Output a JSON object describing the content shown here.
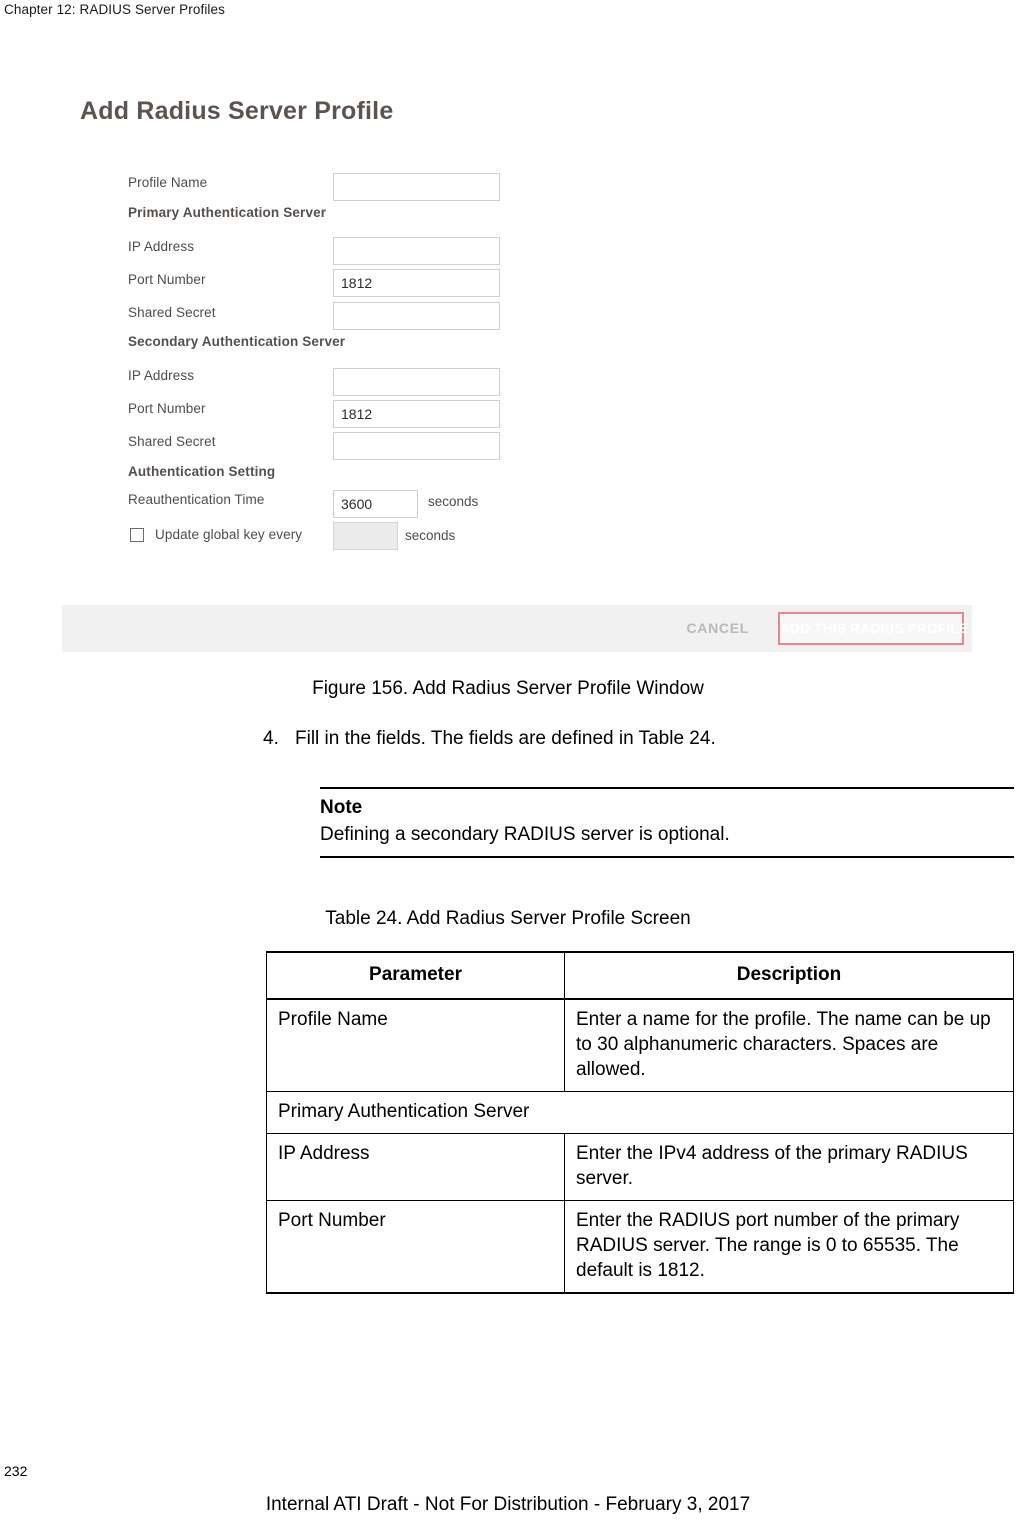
{
  "page": {
    "running_header": "Chapter 12: RADIUS Server Profiles",
    "page_number": "232",
    "footer_note": "Internal ATI Draft - Not For Distribution - February 3, 2017"
  },
  "figure": {
    "caption": "Figure 156. Add Radius Server Profile Window",
    "screenshot": {
      "title": "Add Radius Server Profile",
      "fields": {
        "profile_name_label": "Profile Name",
        "profile_name_value": "",
        "primary_section_label": "Primary Authentication Server",
        "primary_ip_label": "IP Address",
        "primary_ip_value": "",
        "primary_port_label": "Port Number",
        "primary_port_value": "1812",
        "primary_secret_label": "Shared Secret",
        "primary_secret_value": "",
        "secondary_section_label": "Secondary Authentication Server",
        "secondary_ip_label": "IP Address",
        "secondary_ip_value": "",
        "secondary_port_label": "Port Number",
        "secondary_port_value": "1812",
        "secondary_secret_label": "Shared Secret",
        "secondary_secret_value": "",
        "auth_section_label": "Authentication Setting",
        "reauth_label": "Reauthentication Time",
        "reauth_value": "3600",
        "reauth_unit": "seconds",
        "update_key_label": "Update global key every",
        "update_key_value": "",
        "update_key_unit": "seconds",
        "update_key_checked": false
      },
      "actions": {
        "cancel_label": "CANCEL",
        "submit_label": "ADD THIS RADIUS PROFILE",
        "submit_border_color": "#e8868f"
      }
    }
  },
  "step": {
    "number": "4.",
    "text": "Fill in the fields. The fields are defined in Table 24."
  },
  "note": {
    "title": "Note",
    "text": "Defining a secondary RADIUS server is optional."
  },
  "table": {
    "caption": "Table 24. Add Radius Server Profile Screen",
    "headers": [
      "Parameter",
      "Description"
    ],
    "rows": [
      {
        "parameter": "Profile Name",
        "description": "Enter a name for the profile. The name can be up to 30 alphanumeric characters. Spaces are allowed.",
        "span": false
      },
      {
        "parameter": "Primary Authentication Server",
        "description": "",
        "span": true
      },
      {
        "parameter": "IP Address",
        "description": "Enter the IPv4 address of the primary RADIUS server.",
        "span": false
      },
      {
        "parameter": "Port Number",
        "description": "Enter the RADIUS port number of the primary RADIUS server. The range is 0 to 65535. The default is 1812.",
        "span": false
      }
    ]
  }
}
